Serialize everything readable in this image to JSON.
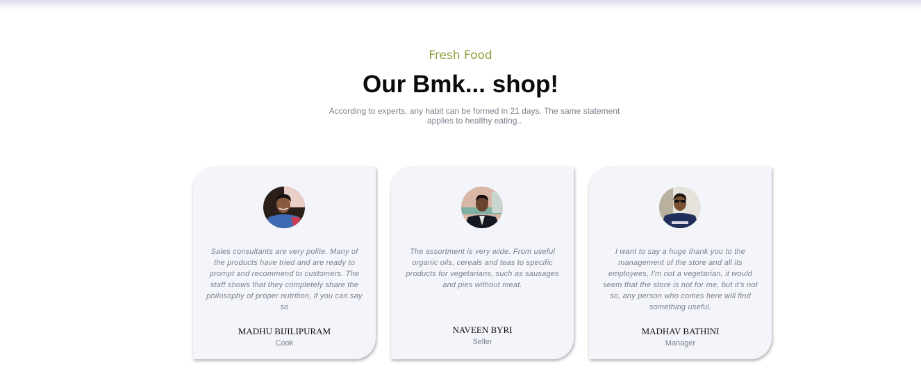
{
  "section": {
    "eyebrow": "Fresh Food",
    "title": "Our Bmk... shop!",
    "subtitle": "According to experts, any habit can be formed in 21 days. The same statement applies to healthy eating.."
  },
  "testimonials": [
    {
      "quote": "Sales consultants are very polite. Many of the products have tried and are ready to prompt and recommend to customers. The staff shows that they completely share the philosophy of proper nutrition, if you can say so",
      "name": "MADHU BIJILIPURAM",
      "role": "Cook",
      "avatar_icon": "person-photo-icon"
    },
    {
      "quote": "The assortment is very wide. From useful organic oils, cereals and teas to specific products for vegetarians, such as sausages and pies without meat.",
      "name": "NAVEEN BYRI",
      "role": "Seller",
      "avatar_icon": "person-photo-icon"
    },
    {
      "quote": "I want to say a huge thank you to the management of the store and all its employees, I'm not a vegetarian, it would seem that the store is not for me, but it's not so, any person who comes here will find something useful.",
      "name": "MADHAV BATHINI",
      "role": "Manager",
      "avatar_icon": "person-photo-icon"
    }
  ],
  "colors": {
    "accent": "#8aa13c",
    "card_bg": "#f4f5fb",
    "muted_text": "#7b7f8c"
  }
}
